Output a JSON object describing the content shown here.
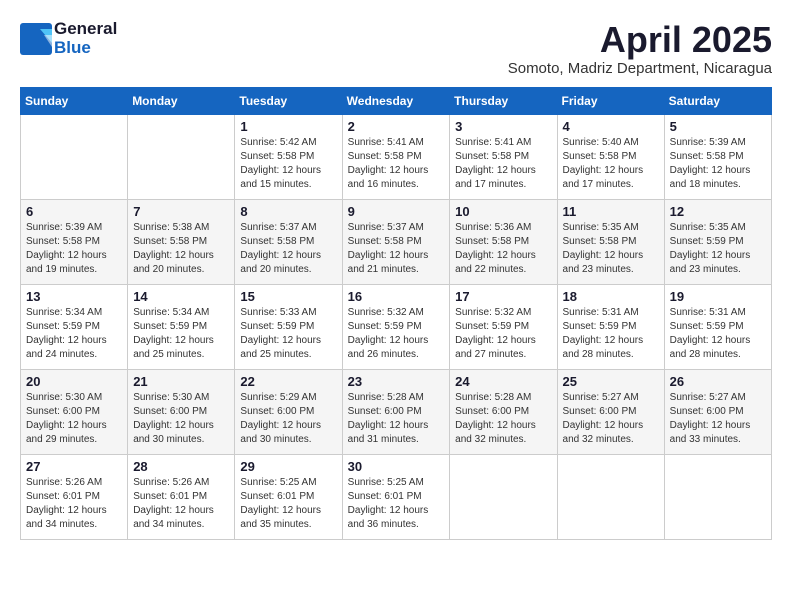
{
  "logo": {
    "general": "General",
    "blue": "Blue"
  },
  "title": "April 2025",
  "location": "Somoto, Madriz Department, Nicaragua",
  "days_of_week": [
    "Sunday",
    "Monday",
    "Tuesday",
    "Wednesday",
    "Thursday",
    "Friday",
    "Saturday"
  ],
  "weeks": [
    [
      {
        "day": "",
        "sunrise": "",
        "sunset": "",
        "daylight": ""
      },
      {
        "day": "",
        "sunrise": "",
        "sunset": "",
        "daylight": ""
      },
      {
        "day": "1",
        "sunrise": "Sunrise: 5:42 AM",
        "sunset": "Sunset: 5:58 PM",
        "daylight": "Daylight: 12 hours and 15 minutes."
      },
      {
        "day": "2",
        "sunrise": "Sunrise: 5:41 AM",
        "sunset": "Sunset: 5:58 PM",
        "daylight": "Daylight: 12 hours and 16 minutes."
      },
      {
        "day": "3",
        "sunrise": "Sunrise: 5:41 AM",
        "sunset": "Sunset: 5:58 PM",
        "daylight": "Daylight: 12 hours and 17 minutes."
      },
      {
        "day": "4",
        "sunrise": "Sunrise: 5:40 AM",
        "sunset": "Sunset: 5:58 PM",
        "daylight": "Daylight: 12 hours and 17 minutes."
      },
      {
        "day": "5",
        "sunrise": "Sunrise: 5:39 AM",
        "sunset": "Sunset: 5:58 PM",
        "daylight": "Daylight: 12 hours and 18 minutes."
      }
    ],
    [
      {
        "day": "6",
        "sunrise": "Sunrise: 5:39 AM",
        "sunset": "Sunset: 5:58 PM",
        "daylight": "Daylight: 12 hours and 19 minutes."
      },
      {
        "day": "7",
        "sunrise": "Sunrise: 5:38 AM",
        "sunset": "Sunset: 5:58 PM",
        "daylight": "Daylight: 12 hours and 20 minutes."
      },
      {
        "day": "8",
        "sunrise": "Sunrise: 5:37 AM",
        "sunset": "Sunset: 5:58 PM",
        "daylight": "Daylight: 12 hours and 20 minutes."
      },
      {
        "day": "9",
        "sunrise": "Sunrise: 5:37 AM",
        "sunset": "Sunset: 5:58 PM",
        "daylight": "Daylight: 12 hours and 21 minutes."
      },
      {
        "day": "10",
        "sunrise": "Sunrise: 5:36 AM",
        "sunset": "Sunset: 5:58 PM",
        "daylight": "Daylight: 12 hours and 22 minutes."
      },
      {
        "day": "11",
        "sunrise": "Sunrise: 5:35 AM",
        "sunset": "Sunset: 5:58 PM",
        "daylight": "Daylight: 12 hours and 23 minutes."
      },
      {
        "day": "12",
        "sunrise": "Sunrise: 5:35 AM",
        "sunset": "Sunset: 5:59 PM",
        "daylight": "Daylight: 12 hours and 23 minutes."
      }
    ],
    [
      {
        "day": "13",
        "sunrise": "Sunrise: 5:34 AM",
        "sunset": "Sunset: 5:59 PM",
        "daylight": "Daylight: 12 hours and 24 minutes."
      },
      {
        "day": "14",
        "sunrise": "Sunrise: 5:34 AM",
        "sunset": "Sunset: 5:59 PM",
        "daylight": "Daylight: 12 hours and 25 minutes."
      },
      {
        "day": "15",
        "sunrise": "Sunrise: 5:33 AM",
        "sunset": "Sunset: 5:59 PM",
        "daylight": "Daylight: 12 hours and 25 minutes."
      },
      {
        "day": "16",
        "sunrise": "Sunrise: 5:32 AM",
        "sunset": "Sunset: 5:59 PM",
        "daylight": "Daylight: 12 hours and 26 minutes."
      },
      {
        "day": "17",
        "sunrise": "Sunrise: 5:32 AM",
        "sunset": "Sunset: 5:59 PM",
        "daylight": "Daylight: 12 hours and 27 minutes."
      },
      {
        "day": "18",
        "sunrise": "Sunrise: 5:31 AM",
        "sunset": "Sunset: 5:59 PM",
        "daylight": "Daylight: 12 hours and 28 minutes."
      },
      {
        "day": "19",
        "sunrise": "Sunrise: 5:31 AM",
        "sunset": "Sunset: 5:59 PM",
        "daylight": "Daylight: 12 hours and 28 minutes."
      }
    ],
    [
      {
        "day": "20",
        "sunrise": "Sunrise: 5:30 AM",
        "sunset": "Sunset: 6:00 PM",
        "daylight": "Daylight: 12 hours and 29 minutes."
      },
      {
        "day": "21",
        "sunrise": "Sunrise: 5:30 AM",
        "sunset": "Sunset: 6:00 PM",
        "daylight": "Daylight: 12 hours and 30 minutes."
      },
      {
        "day": "22",
        "sunrise": "Sunrise: 5:29 AM",
        "sunset": "Sunset: 6:00 PM",
        "daylight": "Daylight: 12 hours and 30 minutes."
      },
      {
        "day": "23",
        "sunrise": "Sunrise: 5:28 AM",
        "sunset": "Sunset: 6:00 PM",
        "daylight": "Daylight: 12 hours and 31 minutes."
      },
      {
        "day": "24",
        "sunrise": "Sunrise: 5:28 AM",
        "sunset": "Sunset: 6:00 PM",
        "daylight": "Daylight: 12 hours and 32 minutes."
      },
      {
        "day": "25",
        "sunrise": "Sunrise: 5:27 AM",
        "sunset": "Sunset: 6:00 PM",
        "daylight": "Daylight: 12 hours and 32 minutes."
      },
      {
        "day": "26",
        "sunrise": "Sunrise: 5:27 AM",
        "sunset": "Sunset: 6:00 PM",
        "daylight": "Daylight: 12 hours and 33 minutes."
      }
    ],
    [
      {
        "day": "27",
        "sunrise": "Sunrise: 5:26 AM",
        "sunset": "Sunset: 6:01 PM",
        "daylight": "Daylight: 12 hours and 34 minutes."
      },
      {
        "day": "28",
        "sunrise": "Sunrise: 5:26 AM",
        "sunset": "Sunset: 6:01 PM",
        "daylight": "Daylight: 12 hours and 34 minutes."
      },
      {
        "day": "29",
        "sunrise": "Sunrise: 5:25 AM",
        "sunset": "Sunset: 6:01 PM",
        "daylight": "Daylight: 12 hours and 35 minutes."
      },
      {
        "day": "30",
        "sunrise": "Sunrise: 5:25 AM",
        "sunset": "Sunset: 6:01 PM",
        "daylight": "Daylight: 12 hours and 36 minutes."
      },
      {
        "day": "",
        "sunrise": "",
        "sunset": "",
        "daylight": ""
      },
      {
        "day": "",
        "sunrise": "",
        "sunset": "",
        "daylight": ""
      },
      {
        "day": "",
        "sunrise": "",
        "sunset": "",
        "daylight": ""
      }
    ]
  ]
}
